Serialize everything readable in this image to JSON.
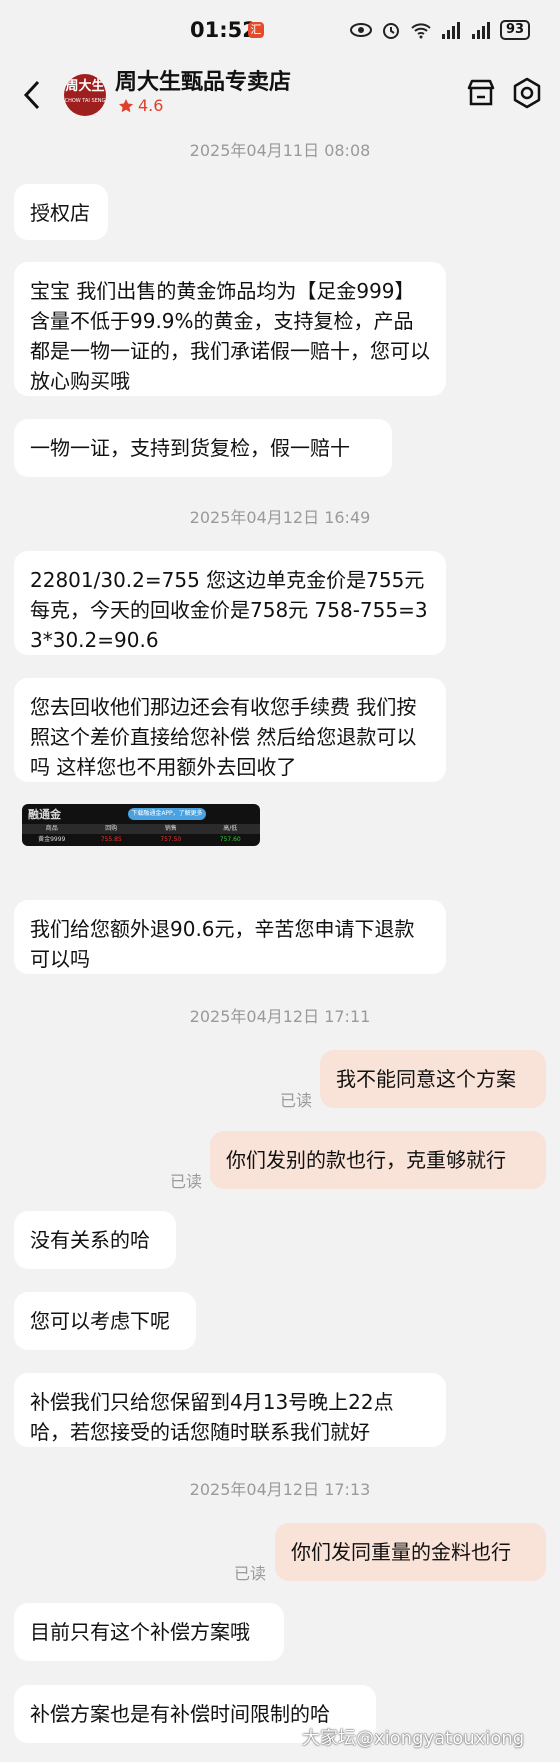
{
  "status_bar": {
    "time": "01:52",
    "notif_badge": "汇",
    "battery": "93"
  },
  "header": {
    "shop_name": "周大生甄品专卖店",
    "rating": "4.6",
    "logo_text": "周大生",
    "logo_sub": "CHOW TAI SENG"
  },
  "timestamps": [
    "2025年04月11日 08:08",
    "2025年04月12日 16:49",
    "2025年04月12日 17:11",
    "2025年04月12日 17:13"
  ],
  "messages": [
    "授权店",
    "宝宝 我们出售的黄金饰品均为【足金999】含量不低于99.9%的黄金，支持复检，产品都是一物一证的，我们承诺假一赔十，您可以放心购买哦",
    "一物一证，支持到货复检，假一赔十",
    "22801/30.2=755 您这边单克金价是755元每克，今天的回收金价是758元 758-755=3 3*30.2=90.6",
    "您去回收他们那边还会有收您手续费 我们按照这个差价直接给您补偿 然后给您退款可以吗 这样您也不用额外去回收了",
    "我们给您额外退90.6元，辛苦您申请下退款可以吗",
    "我不能同意这个方案",
    "你们发别的款也行，克重够就行",
    "没有关系的哈",
    "您可以考虑下呢",
    "补偿我们只给您保留到4月13号晚上22点哈，若您接受的话您随时联系我们就好",
    "你们发同重量的金料也行",
    "目前只有这个补偿方案哦",
    "补偿方案也是有补偿时间限制的哈"
  ],
  "read_label": "已读",
  "image_card": {
    "brand": "融通金",
    "pill": "下载融通金APP，了解更多",
    "headers": [
      "商品",
      "回购",
      "销售",
      "高/低"
    ],
    "row": [
      "黄金9999",
      "755.85",
      "757.50",
      "757.60"
    ]
  },
  "watermark": "大家坛@xiongyatouxiong",
  "colors": {
    "my_bubble": "#f9e2d8",
    "star": "#e0402b"
  }
}
